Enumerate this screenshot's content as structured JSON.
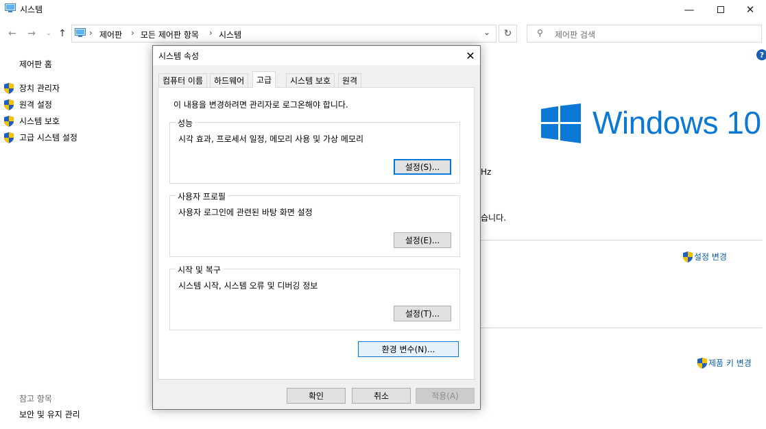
{
  "window": {
    "title": "시스템",
    "minimize_icon": "minimize-icon",
    "maximize_icon": "maximize-icon",
    "close_icon": "close-icon"
  },
  "address_bar": {
    "breadcrumbs": [
      "제어판",
      "모든 제어판 항목",
      "시스템"
    ],
    "search_placeholder": "제어판 검색"
  },
  "sidebar": {
    "home": "제어판 홈",
    "items": [
      {
        "label": "장치 관리자",
        "icon": "shield-icon"
      },
      {
        "label": "원격 설정",
        "icon": "shield-icon"
      },
      {
        "label": "시스템 보호",
        "icon": "shield-icon"
      },
      {
        "label": "고급 시스템 설정",
        "icon": "shield-icon"
      }
    ],
    "see_also_title": "참고 항목",
    "see_also_items": [
      "보안 및 유지 관리"
    ]
  },
  "main": {
    "brand": "Windows 10",
    "partial_text_hz": "Hz",
    "partial_text_sentence": "습니다.",
    "change_settings": "설정 변경",
    "change_product_key": "제품 키 변경"
  },
  "dialog": {
    "title": "시스템 속성",
    "tabs": [
      "컴퓨터 이름",
      "하드웨어",
      "고급",
      "시스템 보호",
      "원격"
    ],
    "active_tab": "고급",
    "notice": "이 내용을 변경하려면 관리자로 로그온해야 합니다.",
    "groups": [
      {
        "title": "성능",
        "description": "시각 효과, 프로세서 일정, 메모리 사용 및 가상 메모리",
        "button": "설정(S)..."
      },
      {
        "title": "사용자 프로필",
        "description": "사용자 로그인에 관련된 바탕 화면 설정",
        "button": "설정(E)..."
      },
      {
        "title": "시작 및 복구",
        "description": "시스템 시작, 시스템 오류 및 디버깅 정보",
        "button": "설정(T)..."
      }
    ],
    "env_button": "환경 변수(N)...",
    "ok": "확인",
    "cancel": "취소",
    "apply": "적용(A)"
  },
  "colors": {
    "accent": "#0078d7",
    "windows_blue": "#0a78d4",
    "link": "#0b5cad"
  }
}
